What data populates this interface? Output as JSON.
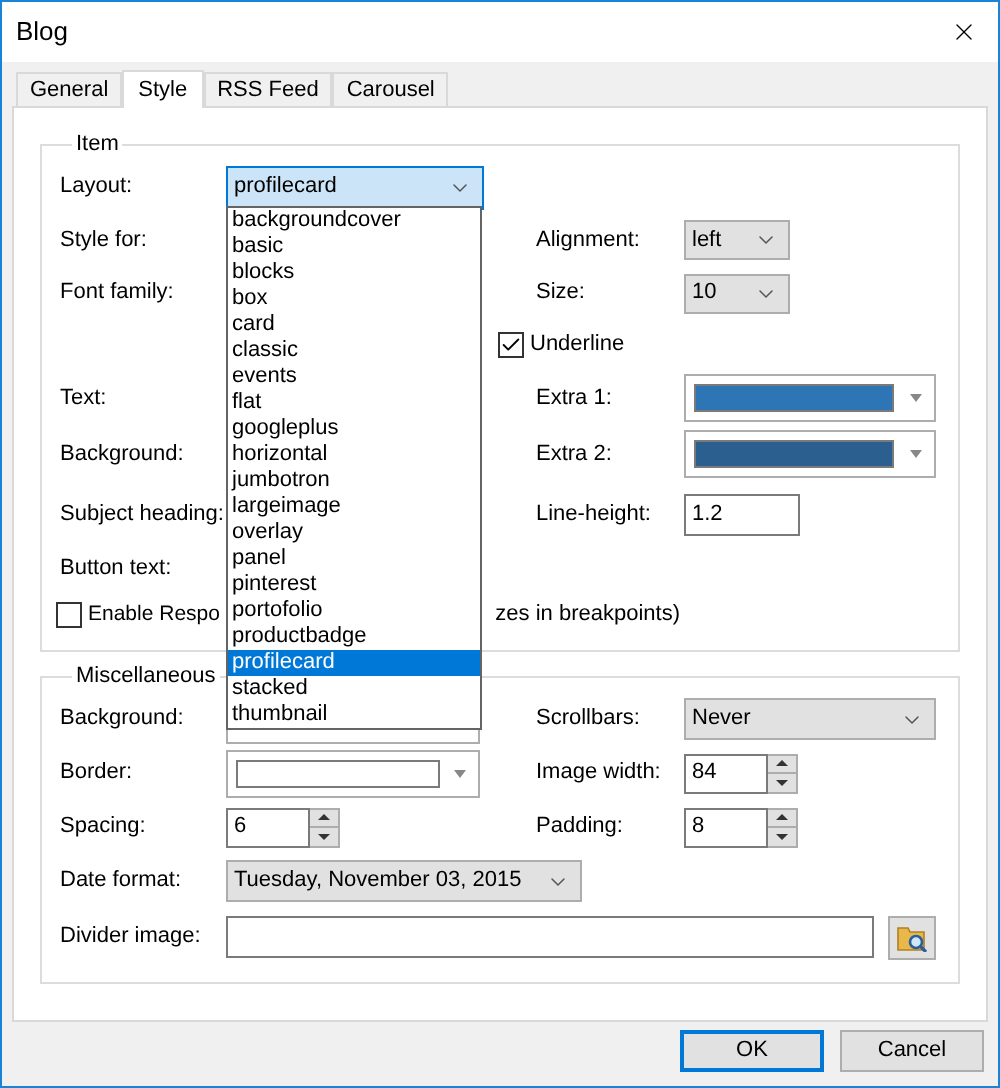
{
  "window": {
    "title": "Blog"
  },
  "tabs": [
    {
      "label": "General",
      "selected": false
    },
    {
      "label": "Style",
      "selected": true
    },
    {
      "label": "RSS Feed",
      "selected": false
    },
    {
      "label": "Carousel",
      "selected": false
    }
  ],
  "item_group": {
    "title": "Item",
    "layout": {
      "label": "Layout:",
      "value": "profilecard",
      "expanded": true,
      "options": [
        {
          "label": "backgroundcover",
          "selected": false
        },
        {
          "label": "basic",
          "selected": false
        },
        {
          "label": "blocks",
          "selected": false
        },
        {
          "label": "box",
          "selected": false
        },
        {
          "label": "card",
          "selected": false
        },
        {
          "label": "classic",
          "selected": false
        },
        {
          "label": "events",
          "selected": false
        },
        {
          "label": "flat",
          "selected": false
        },
        {
          "label": "googleplus",
          "selected": false
        },
        {
          "label": "horizontal",
          "selected": false
        },
        {
          "label": "jumbotron",
          "selected": false
        },
        {
          "label": "largeimage",
          "selected": false
        },
        {
          "label": "overlay",
          "selected": false
        },
        {
          "label": "panel",
          "selected": false
        },
        {
          "label": "pinterest",
          "selected": false
        },
        {
          "label": "portofolio",
          "selected": false
        },
        {
          "label": "productbadge",
          "selected": false
        },
        {
          "label": "profilecard",
          "selected": true
        },
        {
          "label": "stacked",
          "selected": false
        },
        {
          "label": "thumbnail",
          "selected": false
        }
      ]
    },
    "style_for": {
      "label": "Style for:"
    },
    "alignment": {
      "label": "Alignment:",
      "value": "left"
    },
    "font_family": {
      "label": "Font family:"
    },
    "size": {
      "label": "Size:",
      "value": "10"
    },
    "underline": {
      "label": "Underline",
      "checked": true
    },
    "text": {
      "label": "Text:"
    },
    "extra_1": {
      "label": "Extra 1:",
      "color": "#2e75b6"
    },
    "background": {
      "label": "Background:"
    },
    "extra_2": {
      "label": "Extra 2:",
      "color": "#2a5f8f"
    },
    "subject_heading": {
      "label": "Subject heading:"
    },
    "line_height": {
      "label": "Line-height:",
      "value": "1.2"
    },
    "button_text": {
      "label": "Button text:"
    },
    "responsive": {
      "label_start": "Enable Respo",
      "label_end": "zes in breakpoints)",
      "checked": false
    }
  },
  "misc_group": {
    "title": "Miscellaneous",
    "background": {
      "label": "Background:"
    },
    "scrollbars": {
      "label": "Scrollbars:",
      "value": "Never"
    },
    "border": {
      "label": "Border:",
      "color": "#ffffff"
    },
    "image_width": {
      "label": "Image width:",
      "value": "84"
    },
    "spacing": {
      "label": "Spacing:",
      "value": "6"
    },
    "padding": {
      "label": "Padding:",
      "value": "8"
    },
    "date_format": {
      "label": "Date format:",
      "value": "Tuesday, November 03, 2015"
    },
    "divider_image": {
      "label": "Divider image:"
    }
  },
  "buttons": [
    {
      "label": "OK",
      "default": true
    },
    {
      "label": "Cancel",
      "default": false
    }
  ]
}
